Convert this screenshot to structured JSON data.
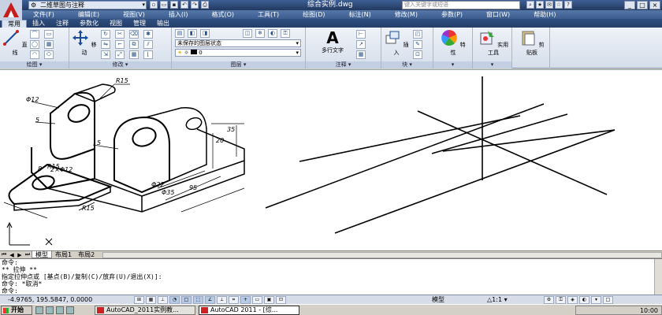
{
  "titlebar": {
    "workspace": "二维草图与注释",
    "document": "综合实例.dwg",
    "help_placeholder": "键入关键字或短语"
  },
  "menu": [
    "文件(F)",
    "编辑(E)",
    "视图(V)",
    "插入(I)",
    "格式(O)",
    "工具(T)",
    "绘图(D)",
    "标注(N)",
    "修改(M)",
    "参数(P)",
    "窗口(W)",
    "帮助(H)"
  ],
  "ribbon_tabs": [
    "常用",
    "插入",
    "注释",
    "参数化",
    "视图",
    "管理",
    "输出"
  ],
  "ribbon": {
    "line": "直线",
    "draw": "绘图",
    "move": "移动",
    "modify": "修改",
    "layer_state": "未保存的图层状态",
    "layer_current": "0",
    "layers": "图层",
    "mtext": "多行文字",
    "annotation": "注释",
    "insert": "插入",
    "block": "块",
    "properties": "特性",
    "utilities": "实用工具",
    "clipboard": "剪贴板"
  },
  "drawing": {
    "labels": [
      "R15",
      "Φ12",
      "5",
      "5",
      "R15",
      "Φ22",
      "Φ35",
      "95",
      "R15",
      "35",
      "20",
      "8",
      "2×Φ12"
    ]
  },
  "layout_tabs": [
    "模型",
    "布局1",
    "布局2"
  ],
  "command_lines": [
    "命令:",
    "** 拉伸 **",
    "指定拉伸点或 [基点(B)/复制(C)/放弃(U)/退出(X)]:",
    "命令: *取消*",
    "命令:"
  ],
  "status": {
    "coords": "-4.9765, 195.5847, 0.0000",
    "model": "模型",
    "scale": "1:1"
  },
  "taskbar": {
    "start": "开始",
    "tasks": [
      "AutoCAD_2011实例教...",
      "AutoCAD 2011 - [综..."
    ],
    "clock": "10:00"
  },
  "colors": {
    "title_bar": "#2c4674",
    "ribbon_bg": "#e3e9f3",
    "drawing_bg": "#ffffff"
  }
}
